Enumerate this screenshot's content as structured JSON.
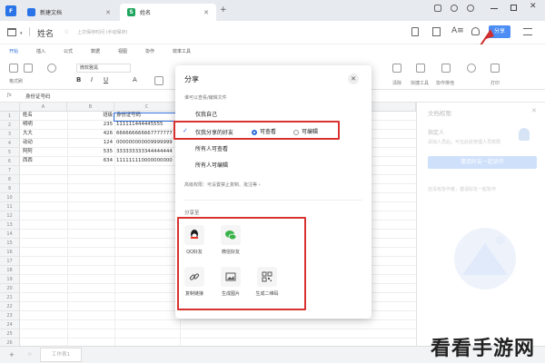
{
  "titlebar": {
    "tabs": [
      {
        "label": "新建文档",
        "active": false
      },
      {
        "label": "姓名",
        "active": true
      }
    ],
    "new_tab": "+"
  },
  "docbar": {
    "doc_title": "姓名",
    "save_status": "上次保存时间 (手动保存)",
    "share_button": "分享",
    "accent": "#4d8ef5"
  },
  "menu": {
    "items": [
      "开始",
      "插入",
      "公式",
      "数据",
      "视图",
      "协作",
      "效率工具"
    ]
  },
  "toolbar": {
    "font_name": "微软雅黑",
    "labels": [
      "格式刷",
      "清除",
      "条件",
      "保存",
      "查找",
      "快捷工具",
      "协作排他",
      "打印"
    ]
  },
  "formula": {
    "cell_ref": "A1",
    "content": "身份证号码"
  },
  "grid": {
    "columns": [
      "A",
      "B",
      "C",
      "D"
    ],
    "headers": [
      "姓名",
      "班级",
      "身份证号码"
    ],
    "rows": [
      {
        "num": "1",
        "name": "姓名",
        "class": "班级",
        "id": "身份证号码"
      },
      {
        "num": "2",
        "name": "明明",
        "class": "235",
        "id": "111111444445555"
      },
      {
        "num": "3",
        "name": "大大",
        "class": "426",
        "id": "666666666667777777"
      },
      {
        "num": "4",
        "name": "动动",
        "class": "124",
        "id": "000000000009999999"
      },
      {
        "num": "5",
        "name": "阿阿",
        "class": "535",
        "id": "333333333344444444"
      },
      {
        "num": "6",
        "name": "西西",
        "class": "634",
        "id": "111111110000000000"
      },
      {
        "num": "7"
      },
      {
        "num": "8"
      },
      {
        "num": "9"
      },
      {
        "num": "10"
      },
      {
        "num": "11"
      },
      {
        "num": "12"
      },
      {
        "num": "13"
      },
      {
        "num": "14"
      },
      {
        "num": "15"
      },
      {
        "num": "16"
      },
      {
        "num": "17"
      },
      {
        "num": "18"
      },
      {
        "num": "19"
      },
      {
        "num": "20"
      },
      {
        "num": "21"
      },
      {
        "num": "22"
      },
      {
        "num": "23"
      },
      {
        "num": "24"
      },
      {
        "num": "25"
      },
      {
        "num": "26"
      }
    ]
  },
  "dialog": {
    "title": "分享",
    "section_label": "谁可以查看/编辑文件",
    "options": [
      "仅我自己",
      "仅我分享的好友",
      "所有人可查看",
      "所有人可编辑"
    ],
    "radio_view": "可查看",
    "radio_edit": "可编辑",
    "advanced": "高级权限：可设置禁止复制、批注等 ›",
    "share_to": "分享至",
    "channels": [
      {
        "label": "QQ好友",
        "icon": "qq-icon",
        "color": "#1e1e1e"
      },
      {
        "label": "微信好友",
        "icon": "wechat-icon",
        "color": "#3bb34a"
      },
      {
        "label": "复制链接",
        "icon": "link-icon",
        "color": "#555"
      },
      {
        "label": "生成图片",
        "icon": "image-icon",
        "color": "#555"
      },
      {
        "label": "生成二维码",
        "icon": "qrcode-icon",
        "color": "#555"
      }
    ],
    "highlight_color": "#d8322f"
  },
  "right_panel": {
    "title": "文档权限",
    "subtitle": "指定人",
    "desc": "添加人员后，可在此处管理人员权限",
    "invite_button": "邀请好友一起协作",
    "empty_text": "还没有协作者，邀请好友一起协作"
  },
  "statusbar": {
    "sheet_tab": "工作表1"
  },
  "watermark": "看看手游网"
}
